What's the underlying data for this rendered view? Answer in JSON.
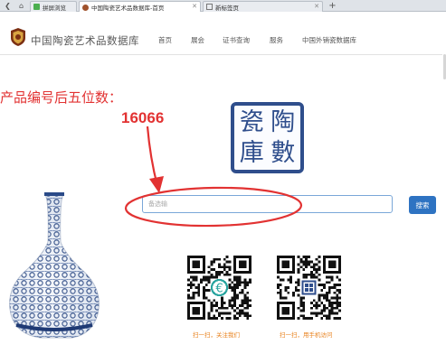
{
  "browser": {
    "tabs": [
      {
        "label": "拼屏浏览",
        "active": false
      },
      {
        "label": "中国陶瓷艺术品数据库-首页",
        "active": true
      },
      {
        "label": "新标签页",
        "active": false
      }
    ],
    "new_tab_symbol": "+"
  },
  "site": {
    "title": "中国陶瓷艺术品数据库",
    "nav": [
      "首页",
      "展会",
      "证书查询",
      "服务",
      "中国外销瓷数据库"
    ]
  },
  "annotation": {
    "instruction": "产品编号后五位数：",
    "code": "16066",
    "color": "#e23232"
  },
  "seal": {
    "chars": [
      "陶",
      "瓷",
      "數",
      "庫"
    ]
  },
  "search": {
    "placeholder": "备选输",
    "value": "",
    "button_label": "搜索"
  },
  "qr": [
    {
      "caption": "扫一扫，关注我们",
      "center_icon": "wechat-logo-icon"
    },
    {
      "caption": "扫一扫，用手机访问",
      "center_icon": "seal-logo-icon"
    }
  ],
  "colors": {
    "accent": "#2e73c2",
    "caption": "#e8821e",
    "seal": "#2f4e8c",
    "annotation": "#e23232"
  }
}
